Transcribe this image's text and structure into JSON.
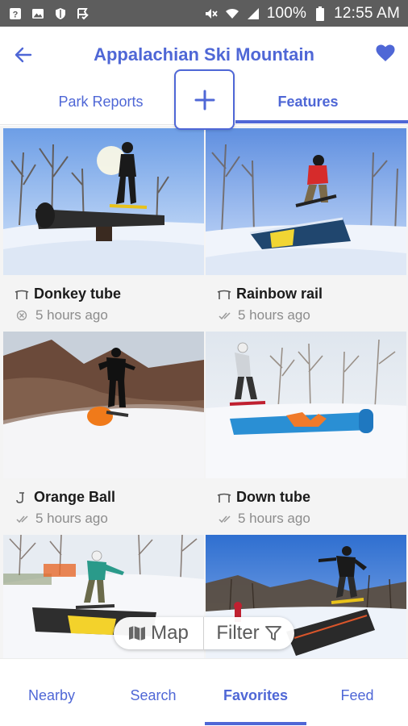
{
  "status_bar": {
    "battery": "100%",
    "time": "12:55 AM",
    "left_icons": [
      "help-icon",
      "image-icon",
      "shield-icon",
      "flag-check-icon"
    ],
    "right_icons": [
      "mute-icon",
      "wifi-icon",
      "signal-icon",
      "battery-icon"
    ]
  },
  "header": {
    "title": "Appalachian Ski Mountain",
    "back_icon": "arrow-left-icon",
    "favorite_icon": "heart-icon"
  },
  "subtabs": {
    "left": "Park Reports",
    "right": "Features",
    "add_label": "+"
  },
  "features": [
    {
      "name": "Donkey tube",
      "time": "5 hours ago",
      "type_icon": "rail-icon",
      "status_icon": "cancel-circle-icon"
    },
    {
      "name": "Rainbow rail",
      "time": "5 hours ago",
      "type_icon": "rail-icon",
      "status_icon": "double-check-icon"
    },
    {
      "name": "Orange Ball",
      "time": "5 hours ago",
      "type_icon": "hook-icon",
      "status_icon": "double-check-icon"
    },
    {
      "name": "Down tube",
      "time": "5 hours ago",
      "type_icon": "rail-icon",
      "status_icon": "double-check-icon"
    }
  ],
  "pill": {
    "map_label": "Map",
    "filter_label": "Filter"
  },
  "bottom_nav": {
    "items": [
      "Nearby",
      "Search",
      "Favorites",
      "Feed"
    ],
    "active": "Favorites"
  },
  "colors": {
    "accent": "#4f67d6",
    "status_bar": "#5d5d5d"
  }
}
